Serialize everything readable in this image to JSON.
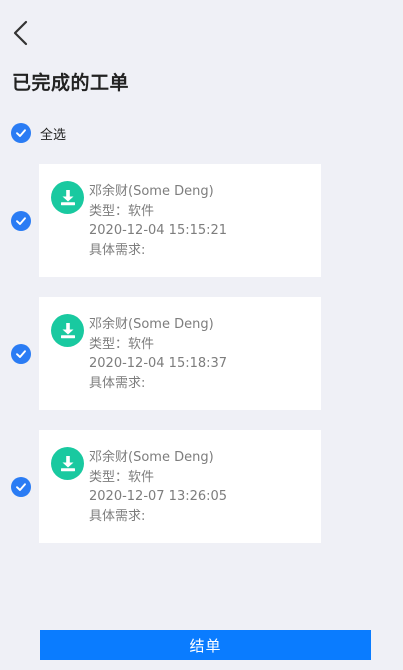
{
  "header": {
    "title": "已完成的工单"
  },
  "select_all": {
    "label": "全选",
    "checked": true
  },
  "orders": [
    {
      "name": "邓余财(Some Deng)",
      "type": "类型：软件",
      "time": "2020-12-04 15:15:21",
      "requirement": "具体需求:",
      "checked": true
    },
    {
      "name": "邓余财(Some Deng)",
      "type": "类型：软件",
      "time": "2020-12-04 15:18:37",
      "requirement": "具体需求:",
      "checked": true
    },
    {
      "name": "邓余财(Some Deng)",
      "type": "类型：软件",
      "time": "2020-12-07 13:26:05",
      "requirement": "具体需求:",
      "checked": true
    }
  ],
  "footer": {
    "submit_label": "结单"
  },
  "colors": {
    "accent": "#2a7cf4",
    "button": "#0a7cff",
    "icon_bg": "#19c9a0",
    "background": "#eff0f6"
  },
  "icons": {
    "back": "chevron-left-icon",
    "check": "check-circle-icon",
    "order": "download-icon"
  }
}
